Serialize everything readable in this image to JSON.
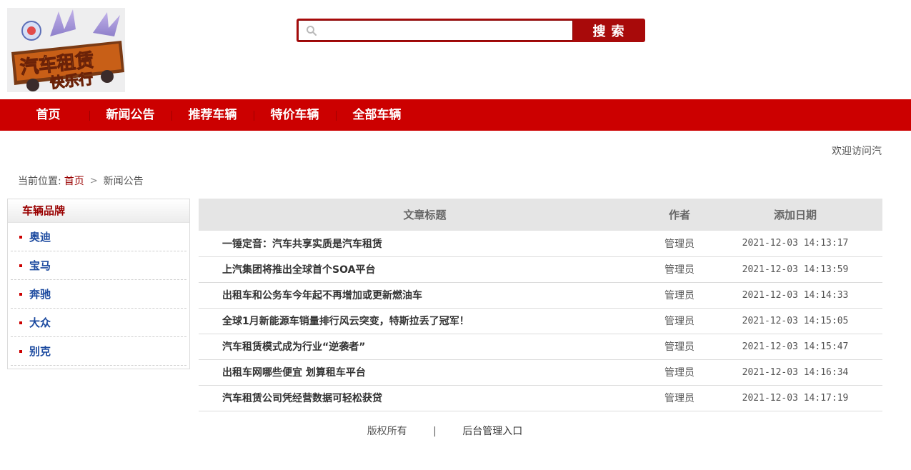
{
  "header": {
    "logo": {
      "alt": "汽车租赁快乐行",
      "line1": "汽车租赁",
      "line2": "快乐行"
    },
    "search": {
      "placeholder": "",
      "value": "",
      "button_label": "搜索"
    }
  },
  "nav": {
    "items": [
      {
        "label": "首页"
      },
      {
        "label": "新闻公告"
      },
      {
        "label": "推荐车辆"
      },
      {
        "label": "特价车辆"
      },
      {
        "label": "全部车辆"
      }
    ]
  },
  "welcome_text": "欢迎访问汽",
  "breadcrumb": {
    "prefix": "当前位置:",
    "home": "首页",
    "separator": ">",
    "current": "新闻公告"
  },
  "sidebar": {
    "title": "车辆品牌",
    "brands": [
      {
        "label": "奥迪"
      },
      {
        "label": "宝马"
      },
      {
        "label": "奔驰"
      },
      {
        "label": "大众"
      },
      {
        "label": "别克"
      }
    ]
  },
  "articles": {
    "headers": {
      "title": "文章标题",
      "author": "作者",
      "date": "添加日期"
    },
    "rows": [
      {
        "title": "一锤定音：汽车共享实质是汽车租赁",
        "author": "管理员",
        "date": "2021-12-03 14:13:17"
      },
      {
        "title": "上汽集团将推出全球首个SOA平台",
        "author": "管理员",
        "date": "2021-12-03 14:13:59"
      },
      {
        "title": "出租车和公务车今年起不再增加或更新燃油车",
        "author": "管理员",
        "date": "2021-12-03 14:14:33"
      },
      {
        "title": "全球1月新能源车销量排行风云突变，特斯拉丢了冠军！",
        "author": "管理员",
        "date": "2021-12-03 14:15:05"
      },
      {
        "title": "汽车租赁模式成为行业“逆袭者”",
        "author": "管理员",
        "date": "2021-12-03 14:15:47"
      },
      {
        "title": "出租车网哪些便宜 划算租车平台",
        "author": "管理员",
        "date": "2021-12-03 14:16:34"
      },
      {
        "title": "汽车租赁公司凭经营数据可轻松获贷",
        "author": "管理员",
        "date": "2021-12-03 14:17:19"
      }
    ]
  },
  "footer": {
    "copyright": "版权所有",
    "divider": "|",
    "admin_link": "后台管理入口"
  },
  "colors": {
    "brand_red": "#cc0000",
    "search_red": "#a80a0a",
    "link_blue": "#1d4ba0",
    "table_header_bg": "#e5e5e5"
  }
}
